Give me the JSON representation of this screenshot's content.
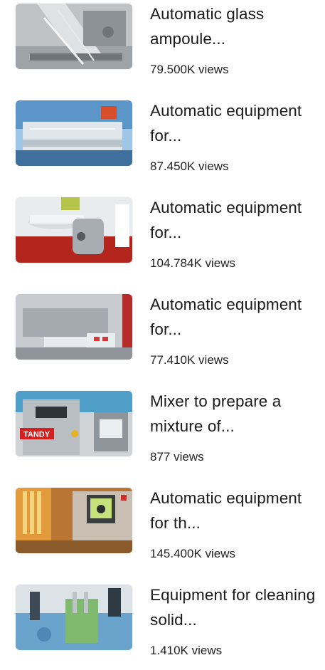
{
  "videos": [
    {
      "title": "Automatic glass ampoule...",
      "views": "79.500K views",
      "thumbnail_icon": "video-thumbnail"
    },
    {
      "title": "Automatic equipment for...",
      "views": "87.450K views",
      "thumbnail_icon": "video-thumbnail"
    },
    {
      "title": "Automatic equipment for...",
      "views": "104.784K views",
      "thumbnail_icon": "video-thumbnail"
    },
    {
      "title": "Automatic equipment for...",
      "views": "77.410K views",
      "thumbnail_icon": "video-thumbnail"
    },
    {
      "title": "Mixer to prepare a mixture of...",
      "views": "877 views",
      "thumbnail_icon": "video-thumbnail",
      "thumbnail_brand": "TANDY"
    },
    {
      "title": "Automatic equipment for th...",
      "views": "145.400K views",
      "thumbnail_icon": "video-thumbnail"
    },
    {
      "title": "Equipment for cleaning solid...",
      "views": "1.410K views",
      "thumbnail_icon": "video-thumbnail"
    }
  ]
}
